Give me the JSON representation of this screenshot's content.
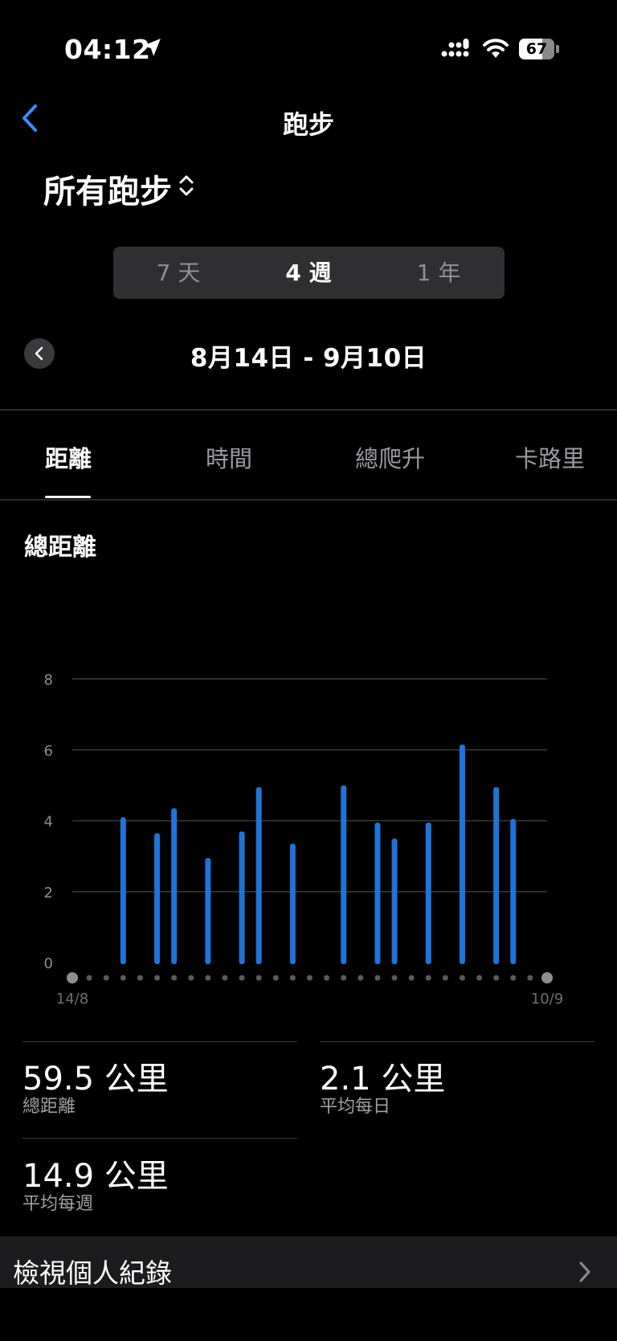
{
  "status_bar": {
    "time": "04:12",
    "battery": "67",
    "battery_level": 0.67
  },
  "nav": {
    "back": "back",
    "title": "跑步"
  },
  "workout_filter": {
    "label": "所有跑步"
  },
  "period_tabs": [
    {
      "label": "7 天",
      "active": false
    },
    {
      "label": "4 週",
      "active": true
    },
    {
      "label": "1 年",
      "active": false
    }
  ],
  "date_range": "8月14日 - 9月10日",
  "metric_tabs": [
    {
      "label": "距離",
      "active": true
    },
    {
      "label": "時間",
      "active": false
    },
    {
      "label": "總爬升",
      "active": false
    },
    {
      "label": "卡路里",
      "active": false
    }
  ],
  "section_title": "總距離",
  "chart_data": {
    "type": "bar",
    "ylim": [
      0,
      8
    ],
    "yticks": [
      0,
      2,
      4,
      6,
      8
    ],
    "x_start_label": "14/8",
    "x_end_label": "10/9",
    "days": 28,
    "values": [
      0,
      0,
      0,
      4.1,
      0,
      3.65,
      4.35,
      0,
      2.95,
      0,
      3.7,
      4.95,
      0,
      3.35,
      0,
      0,
      5.0,
      0,
      3.95,
      3.5,
      0,
      3.95,
      0,
      6.15,
      0,
      4.95,
      4.05,
      0
    ],
    "bar_color": "#1e74d8",
    "grid": true
  },
  "stats": [
    {
      "value": "59.5 公里",
      "label": "總距離"
    },
    {
      "value": "2.1 公里",
      "label": "平均每日"
    },
    {
      "value": "14.9 公里",
      "label": "平均每週"
    }
  ],
  "personal_records": {
    "label": "檢視個人紀錄"
  },
  "colors": {
    "accent": "#3d8bff",
    "background": "#000000"
  }
}
